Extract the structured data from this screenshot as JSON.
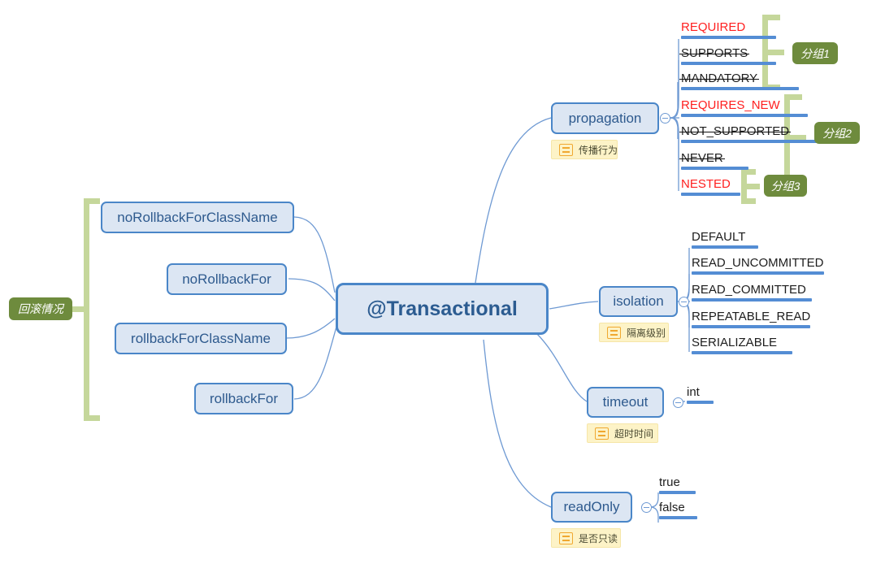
{
  "root": {
    "label": "@Transactional"
  },
  "branches": {
    "propagation": {
      "label": "propagation",
      "note": "传播行为",
      "note_icon": "note-icon",
      "children": [
        {
          "label": "REQUIRED",
          "color": "red",
          "strike": false
        },
        {
          "label": "SUPPORTS",
          "color": "black",
          "strike": true
        },
        {
          "label": "MANDATORY",
          "color": "black",
          "strike": true
        },
        {
          "label": "REQUIRES_NEW",
          "color": "red",
          "strike": false
        },
        {
          "label": "NOT_SUPPORTED",
          "color": "black",
          "strike": true
        },
        {
          "label": "NEVER",
          "color": "black",
          "strike": true
        },
        {
          "label": "NESTED",
          "color": "red",
          "strike": false
        }
      ],
      "groups": [
        {
          "label": "分组1"
        },
        {
          "label": "分组2"
        },
        {
          "label": "分组3"
        }
      ]
    },
    "isolation": {
      "label": "isolation",
      "note": "隔离级别",
      "note_icon": "note-icon",
      "children": [
        {
          "label": "DEFAULT"
        },
        {
          "label": "READ_UNCOMMITTED"
        },
        {
          "label": "READ_COMMITTED"
        },
        {
          "label": "REPEATABLE_READ"
        },
        {
          "label": "SERIALIZABLE"
        }
      ]
    },
    "timeout": {
      "label": "timeout",
      "note": "超时时间",
      "note_icon": "note-icon",
      "children": [
        {
          "label": "int"
        }
      ]
    },
    "readOnly": {
      "label": "readOnly",
      "note": "是否只读",
      "note_icon": "note-icon",
      "children": [
        {
          "label": "true"
        },
        {
          "label": "false"
        }
      ]
    },
    "rollback": {
      "group_label": "回滚情况",
      "children": [
        {
          "label": "noRollbackForClassName"
        },
        {
          "label": "noRollbackFor"
        },
        {
          "label": "rollbackForClassName"
        },
        {
          "label": "rollbackFor"
        }
      ]
    }
  },
  "colors": {
    "node_fill": "#dce6f3",
    "node_border": "#4a86c8",
    "node_text": "#2e5a8e",
    "leaf_bar": "#548dd4",
    "leaf_red": "#ff2020",
    "note_fill": "#fdf3c7",
    "note_icon": "#f0a830",
    "group_fill": "#6e8b3d",
    "bracket": "#c5d79b",
    "connector": "#6f9ad3",
    "background": "#ffffff"
  }
}
